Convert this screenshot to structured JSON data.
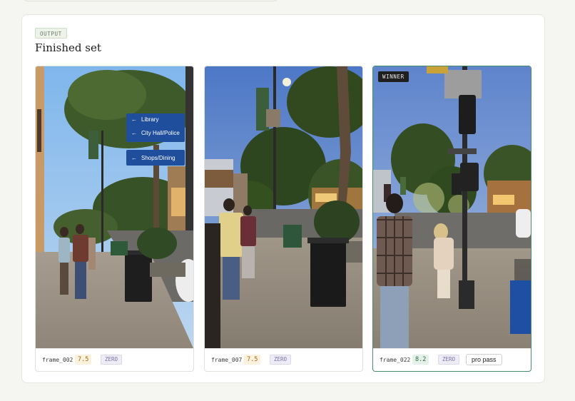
{
  "section": {
    "badge": "OUTPUT",
    "title": "Finished set"
  },
  "frames": [
    {
      "name": "frame_002",
      "score": "7.5",
      "zero": "ZERO",
      "score_color": "#fbf1dc"
    },
    {
      "name": "frame_007",
      "score": "7.5",
      "zero": "ZERO",
      "score_color": "#fbf1dc"
    },
    {
      "name": "frame_022",
      "score": "8.2",
      "zero": "ZERO",
      "winner": "WINNER",
      "action": "pro pass",
      "score_color": "#e4f1e8"
    }
  ],
  "signs": {
    "library": "Library",
    "cityhall": "City Hall/Police",
    "shops": "Shops/Dining"
  },
  "colors": {
    "winner_border": "#4a8b6c",
    "sign_blue": "#1f4e9c"
  }
}
